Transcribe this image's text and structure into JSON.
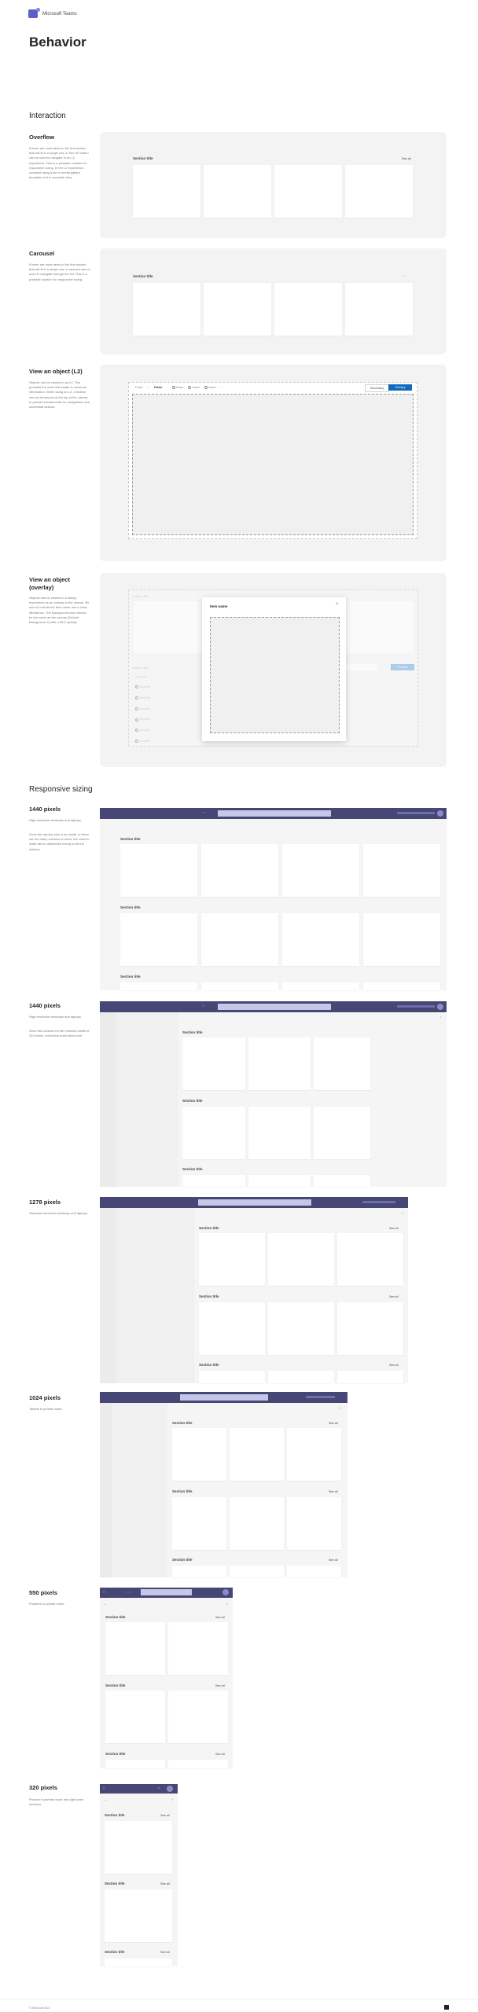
{
  "header": {
    "brand": "Microsoft Teams",
    "logo_icon": "teams-logo-icon",
    "page_title": "Behavior"
  },
  "interaction": {
    "heading": "Interaction",
    "overflow": {
      "title": "Overflow",
      "description": "If there are more items in the first section that will fit in a single row, a 'See all' button can be used to navigate to an L2 experience. This is a possible solution for responsive sizing. In the L2 experience, consider using a list or media gallery template for the complete view.",
      "section_title": "Section title",
      "see_all": "See all"
    },
    "carousel": {
      "title": "Carousel",
      "description": "If there are more items in the first section that will fit in a single row, a carousel can be used to navigate through the list. This is a possible solution for responsive sizing.",
      "section_title": "Section title",
      "prev_icon": "chevron-left-icon",
      "next_icon": "chevron-right-icon"
    },
    "view_l2": {
      "title": "View an object (L2)",
      "description": "Objects can be viewed in an L2. This provides the most real estate to consume information. When using an L2, a toolbar can be introduced at the top of the canvas to provide breadcrumbs for navigations and contextual actions.",
      "breadcrumb": [
        "Folder",
        "Folder"
      ],
      "breadcrumb_separator": ">",
      "actions": [
        "Action",
        "Action",
        "Action"
      ],
      "more": "···",
      "secondary_button": "Secondary",
      "primary_button": "Primary"
    },
    "view_overlay": {
      "title": "View an object (overlay)",
      "description": "Objects can be viewed in a dialog experience as an overlay to the canvas. Be sure to include the item name and a close affordance. The background color should be the same as the canvas (Default Background 2) with a 50% opacity.",
      "bg_section_title": "Section title",
      "bg_list_title": "Section title",
      "header_text": "Header text",
      "body_rows": [
        "Body text",
        "Body text",
        "Body text",
        "Body text",
        "Body text",
        "Body text"
      ],
      "body_col": "Body text",
      "primary_button": "Primary",
      "dialog_title": "Item name",
      "close_icon": "close-icon"
    }
  },
  "responsive": {
    "heading": "Responsive sizing",
    "section_title": "Section title",
    "see_all": "See all",
    "sizes": [
      {
        "title": "1440 pixels",
        "description": [
          "High-resolution desktops and laptops.",
          "Once the window size is too small, or there are too many columns to show, the column width will be distributed evenly to fill the window."
        ]
      },
      {
        "title": "1440 pixels",
        "description": [
          "High-resolution desktops and laptops.",
          "Once the columns hit the minimum width of 240 pixels, horizontal scroll takes over."
        ]
      },
      {
        "title": "1278 pixels",
        "description": [
          "Standard-resolution desktops and laptops."
        ]
      },
      {
        "title": "1024 pixels",
        "description": [
          "Tablets in portrait mode."
        ]
      },
      {
        "title": "550 pixels",
        "description": [
          "Phablets in portrait mode."
        ]
      },
      {
        "title": "320 pixels",
        "description": [
          "Phones in portrait mode and right pane surfaces."
        ]
      }
    ]
  },
  "footer": {
    "copyright": "© Microsoft 2022",
    "logo_icon": "microsoft-logo-icon"
  },
  "colors": {
    "teams_bar": "#464775",
    "primary": "#0f6cbd",
    "panel_bg": "#f3f3f3"
  }
}
